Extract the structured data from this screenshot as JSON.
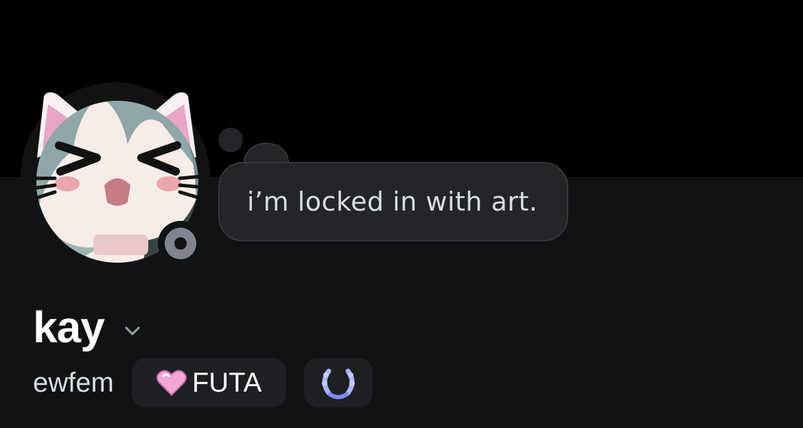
{
  "profile": {
    "display_name": "kay",
    "username": "ewfem",
    "status_text": "i’m locked in with art.",
    "status": "idle",
    "avatar_icon": "cat-ear-anime-avatar",
    "expand_icon": "chevron-down-icon"
  },
  "tags": [
    {
      "label": "FUTA",
      "icon": "pink-heart-icon"
    },
    {
      "label": "",
      "icon": "laurel-wreath-badge-icon"
    }
  ],
  "colors": {
    "banner": "#000000",
    "panel": "#111214",
    "bubble": "#232428",
    "status_idle": "#80848e",
    "chip": "#1e1f22",
    "heart": "#f2a6d6"
  }
}
